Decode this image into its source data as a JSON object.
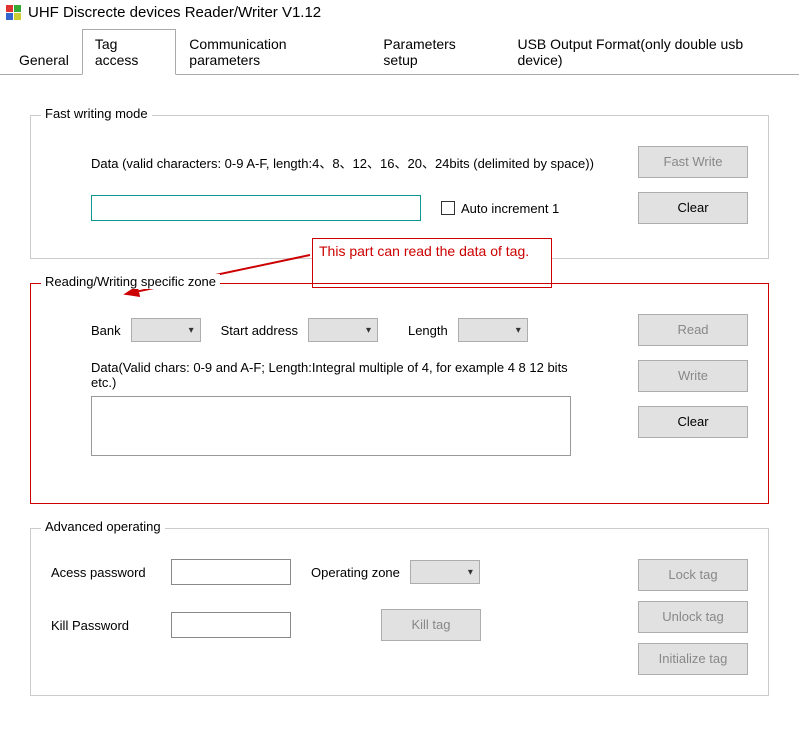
{
  "window": {
    "title": "UHF Discrecte devices Reader/Writer V1.12"
  },
  "tabs": [
    "General",
    "Tag access",
    "Communication parameters",
    "Parameters setup",
    "USB Output Format(only double usb device)"
  ],
  "fastWriting": {
    "legend": "Fast writing mode",
    "dataHint": "Data (valid characters: 0-9 A-F, length:4、8、12、16、20、24bits (delimited by space))",
    "fastWriteBtn": "Fast Write",
    "autoIncrementLabel": "Auto increment 1",
    "clearBtn": "Clear"
  },
  "annotation": {
    "text": "This part can read the data of tag."
  },
  "specificZone": {
    "legend": "Reading/Writing specific zone",
    "bankLabel": "Bank",
    "startAddrLabel": "Start address",
    "lengthLabel": "Length",
    "dataHint": "Data(Valid chars: 0-9 and A-F; Length:Integral multiple of 4, for example 4 8 12 bits etc.)",
    "readBtn": "Read",
    "writeBtn": "Write",
    "clearBtn": "Clear"
  },
  "advanced": {
    "legend": "Advanced operating",
    "accessPwdLabel": "Acess password",
    "operatingZoneLabel": "Operating zone",
    "killPwdLabel": "Kill Password",
    "lockTagBtn": "Lock tag",
    "unlockTagBtn": "Unlock tag",
    "killTagBtn": "Kill tag",
    "initTagBtn": "Initialize tag"
  }
}
